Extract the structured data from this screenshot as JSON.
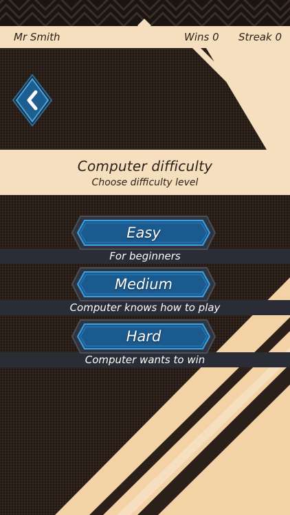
{
  "header": {
    "player_name": "Mr Smith",
    "wins_label": "Wins 0",
    "streak_label": "Streak 0"
  },
  "back_button": {
    "icon": "chevron-left-icon"
  },
  "title_panel": {
    "title": "Computer difficulty",
    "subtitle": "Choose difficulty level"
  },
  "options": [
    {
      "label": "Easy",
      "description": "For beginners"
    },
    {
      "label": "Medium",
      "description": "Computer knows how to play"
    },
    {
      "label": "Hard",
      "description": "Computer wants to win"
    }
  ],
  "colors": {
    "cream": "#f6dfbf",
    "dark_bg": "#2b2019",
    "button_blue": "#1a5f94",
    "button_border": "#3ea0e0",
    "strip": "#2a2c36"
  }
}
